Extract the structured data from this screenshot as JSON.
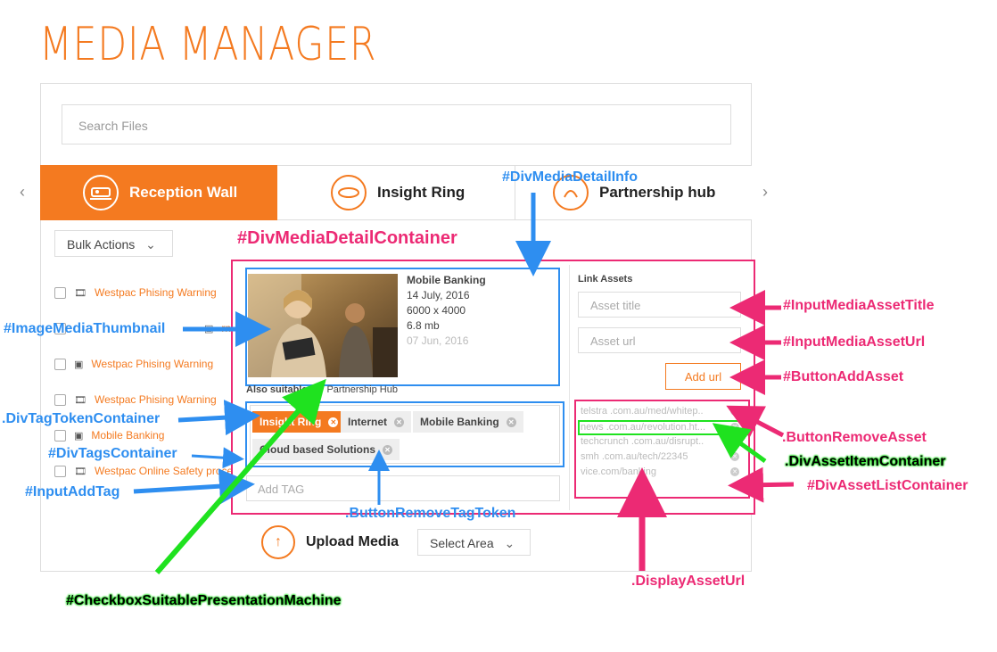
{
  "app_title": "MEDIA MANAGER",
  "search": {
    "placeholder": "Search Files"
  },
  "tabs": [
    {
      "label": "Reception Wall",
      "active": true
    },
    {
      "label": "Insight Ring",
      "active": false
    },
    {
      "label": "Partnership hub",
      "active": false
    }
  ],
  "bulk_actions": "Bulk Actions",
  "files": [
    {
      "name": "Westpac Phising Warning",
      "type": "film-icon"
    },
    {
      "name": "rning",
      "type": "image-icon"
    },
    {
      "name": "Westpac Phising Warning",
      "type": "image-icon"
    },
    {
      "name": "Westpac Phising Warning",
      "type": "film-icon"
    },
    {
      "name": "Mobile Banking",
      "type": "image-icon"
    },
    {
      "name": "Westpac Online Safety proce",
      "type": "film-icon"
    }
  ],
  "media": {
    "title": "Mobile Banking",
    "date": "14 July, 2016",
    "dimensions": "6000 x 4000",
    "size": "6.8 mb",
    "uploaded": "07 Jun, 2016"
  },
  "also_suitable": {
    "label": "Also suitable",
    "option": "Partnership Hub"
  },
  "tags": [
    "Insight Ring",
    "Internet",
    "Mobile Banking",
    "Cloud based Solutions"
  ],
  "add_tag_placeholder": "Add TAG",
  "link_assets": {
    "label": "Link Assets",
    "title_placeholder": "Asset title",
    "url_placeholder": "Asset url",
    "add_button": "Add url"
  },
  "assets": [
    "telstra .com.au/med/whitep..",
    "news .com.au/revolution.ht...",
    "techcrunch .com.au/disrupt..",
    "smh .com.au/tech/22345",
    "vice.com/banking"
  ],
  "upload": {
    "label": "Upload Media",
    "select": "Select Area"
  },
  "annotations": {
    "div_media_detail_info": "#DivMediaDetailInfo",
    "div_media_detail_container": "#DivMediaDetailContainer",
    "image_media_thumbnail": "#ImageMediaThumbnail",
    "div_tag_token_container": ".DivTagTokenContainer",
    "div_tags_container": "#DivTagsContainer",
    "input_add_tag": "#InputAddTag",
    "button_remove_tag_token": ".ButtonRemoveTagToken",
    "checkbox_suitable": "#CheckboxSuitablePresentationMachine",
    "input_media_asset_title": "#InputMediaAssetTitle",
    "input_media_asset_url": "#InputMediaAssetUrl",
    "button_add_asset": "#ButtonAddAsset",
    "button_remove_asset": ".ButtonRemoveAsset",
    "div_asset_item_container": ".DivAssetItemContainer",
    "div_asset_list_container": "#DivAssetListContainer",
    "display_asset_url": ".DisplayAssetUrl"
  },
  "colors": {
    "brand": "#f47a20",
    "annotation_blue": "#2e8ef0",
    "annotation_pink": "#ec2a74",
    "annotation_green": "#1fe21f"
  }
}
